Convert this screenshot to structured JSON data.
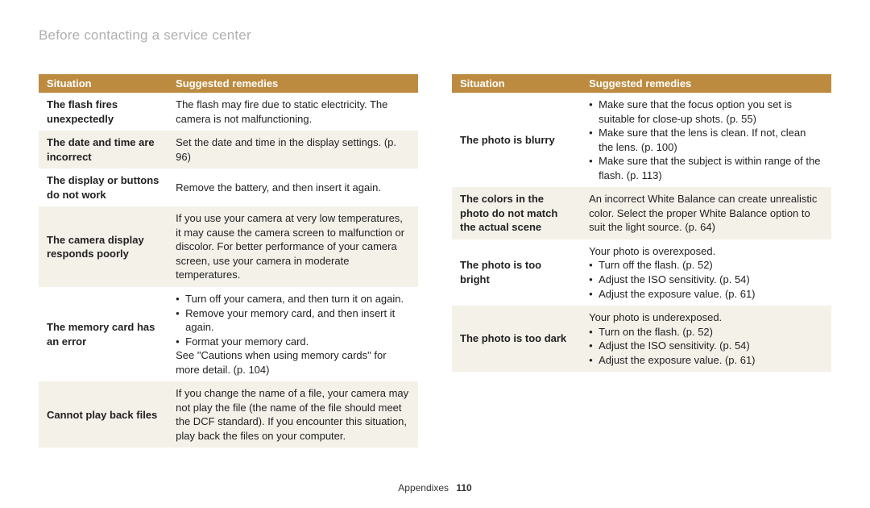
{
  "title": "Before contacting a service center",
  "headers": {
    "situation": "Situation",
    "remedies": "Suggested remedies"
  },
  "footer": {
    "section": "Appendixes",
    "page": "110"
  },
  "leftRows": [
    {
      "situation": "The flash fires unexpectedly",
      "remedy": "The flash may fire due to static electricity. The camera is not malfunctioning."
    },
    {
      "situation": "The date and time are incorrect",
      "remedy": "Set the date and time in the display settings. (p. 96)"
    },
    {
      "situation": "The display or buttons do not work",
      "remedy": "Remove the battery, and then insert it again."
    },
    {
      "situation": "The camera display responds poorly",
      "remedy": "If you use your camera at very low temperatures, it may cause the camera screen to malfunction or discolor. For better performance of your camera screen, use your camera in moderate temperatures."
    },
    {
      "situation": "The memory card has an error",
      "bullets": [
        "Turn off your camera, and then turn it on again.",
        "Remove your memory card, and then insert it again.",
        "Format your memory card."
      ],
      "after": "See \"Cautions when using memory cards\" for more detail. (p. 104)"
    },
    {
      "situation": "Cannot play back files",
      "remedy": "If you change the name of a file, your camera may not play the file (the name of the file should meet the DCF standard). If you encounter this situation, play back the files on your computer."
    }
  ],
  "rightRows": [
    {
      "situation": "The photo is blurry",
      "bullets": [
        "Make sure that the focus option you set is suitable for close-up shots. (p. 55)",
        "Make sure that the lens is clean. If not, clean the lens. (p. 100)",
        "Make sure that the subject is within range of the flash. (p. 113)"
      ]
    },
    {
      "situation": "The colors in the photo do not match the actual scene",
      "remedy": "An incorrect White Balance can create unrealistic color. Select the proper White Balance option to suit the light source. (p. 64)"
    },
    {
      "situation": "The photo is too bright",
      "before": "Your photo is overexposed.",
      "bullets": [
        "Turn off the flash. (p. 52)",
        "Adjust the ISO sensitivity. (p. 54)",
        "Adjust the exposure value. (p. 61)"
      ]
    },
    {
      "situation": "The photo is too dark",
      "before": "Your photo is underexposed.",
      "bullets": [
        "Turn on the flash. (p. 52)",
        "Adjust the ISO sensitivity. (p. 54)",
        "Adjust the exposure value. (p. 61)"
      ]
    }
  ]
}
